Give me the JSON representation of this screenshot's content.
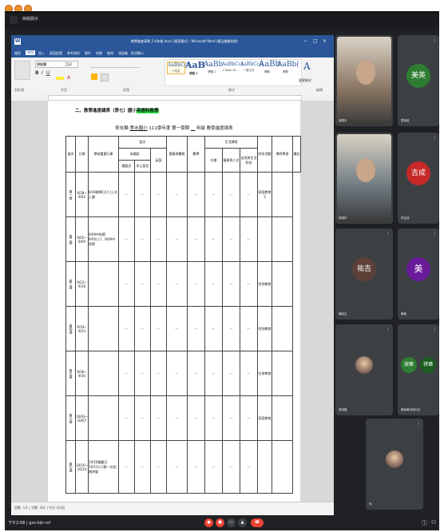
{
  "meet": {
    "title": "簡報顯示",
    "time_code": "下午2:08",
    "meeting_code": "gxv-kjtr-rsf"
  },
  "word": {
    "doc_title": "教學進度表單_5-6年級.docx [相容模式] - Microsoft Word (產品啟動失敗)",
    "window_controls": [
      "−",
      "□",
      "×"
    ],
    "tabs": [
      "檔案",
      "常用",
      "插入",
      "版面配置",
      "參考資料",
      "郵件",
      "校閱",
      "檢視",
      "增益集",
      "取消顯示"
    ],
    "active_tab": "常用",
    "font_name": "標楷體",
    "font_size": "12",
    "groups": [
      "剪貼簿",
      "字型",
      "段落",
      "樣式",
      "編輯"
    ],
    "styles": [
      {
        "sample": "AaBbCcI",
        "name": "+內文"
      },
      {
        "sample": "AaB",
        "name": "標題 1"
      },
      {
        "sample": "AaBb",
        "name": "標題 2"
      },
      {
        "sample": "AaBbCcI",
        "name": "+Table Pa..."
      },
      {
        "sample": "AaBbCcE",
        "name": "一般文字"
      },
      {
        "sample": "AaBb",
        "name": "標題"
      },
      {
        "sample": "AaBb(",
        "name": "標題"
      }
    ],
    "change_styles": "變更樣式",
    "status_left": "頁數: 1/1 | 字數: 261 | 中文 (台灣)"
  },
  "doc": {
    "heading_prefix": "二、教學進度總表（表七）國小",
    "heading_highlight": "英語科教學",
    "school_prefix": "彰化縣",
    "school_name": "秀水國小",
    "year_term": "111學年度 第一學期",
    "grade_suffix": "年級 教學進度總表",
    "mark": "↵",
    "table": {
      "top_headers": [
        "週次",
        "日期",
        "學校重要行事",
        "語文",
        "健康與體育",
        "數學",
        "生活課程",
        "綜合活動",
        "彈性學習",
        "備註"
      ],
      "sub_headers": {
        "lang_group": "本國語",
        "lang_cols": [
          "國語文",
          "本土語言",
          "英語"
        ],
        "life_cols": [
          "社會",
          "藝術與人文",
          "自然與生活科技"
        ]
      },
      "rows": [
        {
          "week": "第一週",
          "date": "8/28~9/02",
          "events": "8/30開學日(二)上式上課"
        },
        {
          "week": "第二週",
          "date": "9/05~9/09",
          "events": "9/09中秋節 9/05(二)、9/09中秋節"
        },
        {
          "week": "第三週",
          "date": "9/12~9/16",
          "events": ""
        },
        {
          "week": "第四週",
          "date": "9/19~9/23",
          "events": ""
        },
        {
          "week": "第五週",
          "date": "9/26~9/30",
          "events": ""
        },
        {
          "week": "第六週",
          "date": "10/03~10/07",
          "events": ""
        },
        {
          "week": "第七週",
          "date": "10/10~10/14",
          "events": "10/10國慶日 10/11(二)第一次定期評量"
        }
      ],
      "flex_notes": [
        "家庭教育3",
        "",
        "性別教育",
        "性別教育",
        "生命教育",
        "家庭教育",
        ""
      ]
    }
  },
  "participants": [
    {
      "name": "吳寶月",
      "kind": "camera"
    },
    {
      "name": "詹美英",
      "avatar_text": "美英",
      "color": "#2e7d32"
    },
    {
      "name": "林雅玲",
      "kind": "camera"
    },
    {
      "name": "李吉成",
      "avatar_text": "吉成",
      "color": "#c62828"
    },
    {
      "name": "陳祐吉",
      "avatar_text": "祐吉",
      "color": "#5d4037"
    },
    {
      "name": "陳美",
      "avatar_text": "美",
      "color": "#6a1b9a"
    },
    {
      "name": "張淑媛",
      "kind": "photo"
    },
    {
      "name": "陳淑華/其他2位",
      "avatar_text": "淑華",
      "avatar_text2": "祺瑋",
      "color": "#2e7d32"
    },
    {
      "name": "你",
      "kind": "photo"
    }
  ],
  "colors": {
    "meet_bg": "#202124",
    "word_blue": "#2b579a",
    "highlight": "#2ee04a",
    "end_call": "#ea4335"
  }
}
